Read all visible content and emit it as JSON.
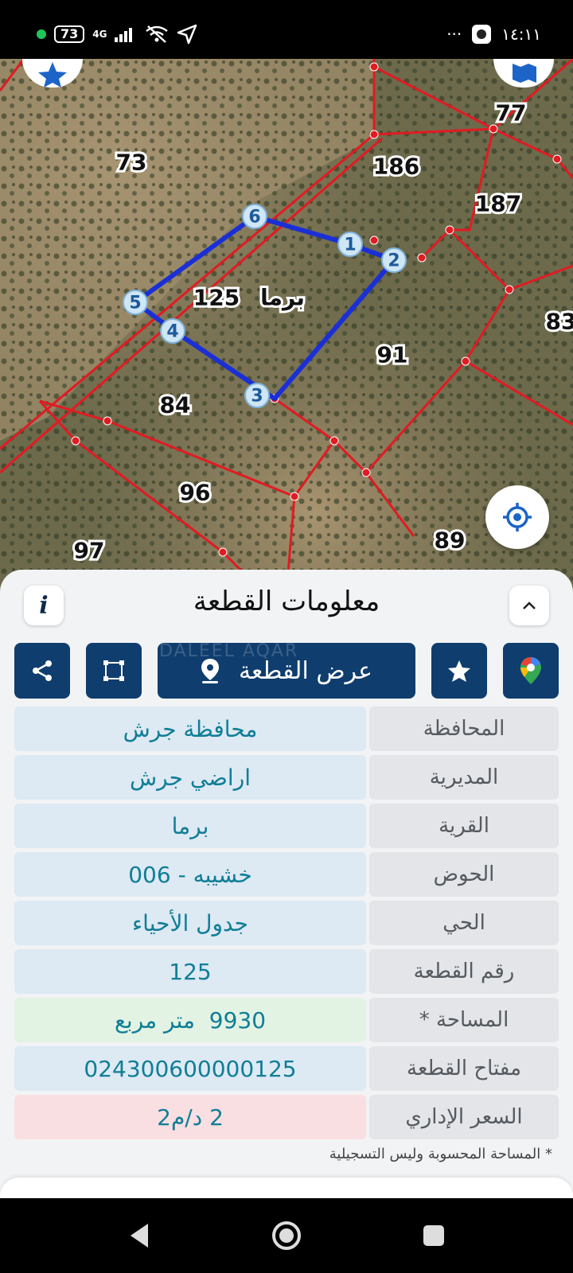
{
  "status_bar": {
    "battery": "73",
    "network": "4G",
    "time": "١٤:١١",
    "more": "···"
  },
  "map": {
    "plot_labels": [
      {
        "id": "73",
        "text": "73"
      },
      {
        "id": "77",
        "text": "77"
      },
      {
        "id": "186",
        "text": "186"
      },
      {
        "id": "187",
        "text": "187"
      },
      {
        "id": "83",
        "text": "83"
      },
      {
        "id": "91",
        "text": "91"
      },
      {
        "id": "84",
        "text": "84"
      },
      {
        "id": "96",
        "text": "96"
      },
      {
        "id": "97",
        "text": "97"
      },
      {
        "id": "89",
        "text": "89"
      },
      {
        "id": "125",
        "text": "125"
      }
    ],
    "village_label": "برما",
    "vertices": [
      "1",
      "2",
      "3",
      "4",
      "5",
      "6"
    ],
    "colors": {
      "boundary": "#e11b22",
      "selected_plot": "#1b2fd6"
    }
  },
  "panel": {
    "title": "معلومات القطعة",
    "view_button": "عرض القطعة",
    "watermark": "DALEEL AQAR",
    "rows": [
      {
        "label": "المحافظة",
        "value": "محافظة جرش"
      },
      {
        "label": "المديرية",
        "value": "اراضي جرش"
      },
      {
        "label": "القرية",
        "value": "برما"
      },
      {
        "label": "الحوض",
        "value": "خشيبه - 006"
      },
      {
        "label": "الحي",
        "value": "جدول الأحياء"
      },
      {
        "label": "رقم القطعة",
        "value": "125"
      },
      {
        "label": "المساحة *",
        "value": "9930  متر مربع"
      },
      {
        "label": "مفتاح القطعة",
        "value": "024300600000125"
      },
      {
        "label": "السعر الإداري",
        "value": "2 د/م2"
      }
    ],
    "footnote": "* المساحة المحسوبة وليس التسجيلية"
  }
}
